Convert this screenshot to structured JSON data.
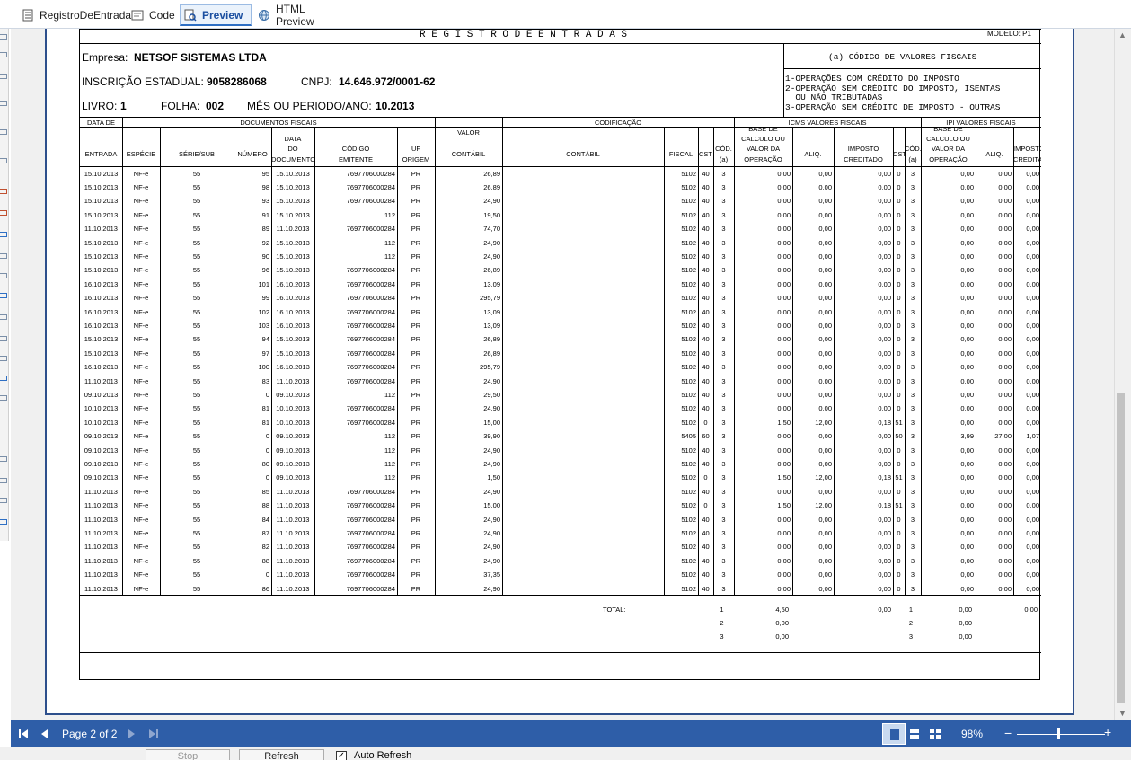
{
  "tabs": [
    {
      "label": "RegistroDeEntrada",
      "icon": "document-icon",
      "active": false
    },
    {
      "label": "Code",
      "icon": "code-icon",
      "active": false
    },
    {
      "label": "Preview",
      "icon": "preview-icon",
      "active": true
    },
    {
      "label": "HTML Preview",
      "icon": "globe-icon",
      "active": false
    }
  ],
  "report": {
    "title": "R E G I S T R O    D E    E N T R A D A S",
    "modelo": "MODELO: P1",
    "empresa_label": "Empresa:",
    "empresa": "NETSOF SISTEMAS LTDA",
    "ie_label": "INSCRIÇÃO ESTADUAL:",
    "ie": "9058286068",
    "cnpj_label": "CNPJ:",
    "cnpj": "14.646.972/0001-62",
    "livro_label": "LIVRO:",
    "livro": "1",
    "folha_label": "FOLHA:",
    "folha": "002",
    "mes_label": "MÊS OU PERIODO/ANO:",
    "mes": "10.2013",
    "codigo_title": "(a) CÓDIGO DE VALORES FISCAIS",
    "codigo_lines": [
      "1-OPERAÇÕES COM CRÉDITO DO IMPOSTO",
      "2-OPERAÇÃO SEM CRÉDITO DO IMPOSTO, ISENTAS",
      "  OU NÃO TRIBUTADAS",
      "3-OPERAÇÃO SEM CRÉDITO DE IMPOSTO - OUTRAS"
    ],
    "groups": {
      "data_de": "DATA DE",
      "documentos": "DOCUMENTOS FISCAIS",
      "codificacao": "CODIFICAÇÃO",
      "icms": "ICMS VALORES FISCAIS",
      "ipi": "IPI VALORES FISCAIS"
    },
    "headers": {
      "entrada": "ENTRADA",
      "especie": "ESPÉCIE",
      "serie": "SÉRIE/SUB",
      "numero": "NÚMERO",
      "data_doc": [
        "DATA",
        "DO",
        "DOCUMENTO"
      ],
      "codigo_emit": [
        "CÓDIGO",
        "EMITENTE"
      ],
      "uf": [
        "UF",
        "ORIGEM"
      ],
      "valor": [
        "VALOR",
        "CONTÁBIL"
      ],
      "contabil": "CONTÁBIL",
      "fiscal": "FISCAL",
      "cst": "CST",
      "cod": [
        "CÓD.",
        "(a)"
      ],
      "base": [
        "BASE DE",
        "CALCULO OU",
        "VALOR DA",
        "OPERAÇÃO"
      ],
      "aliq": "ALIQ.",
      "imposto": [
        "IMPOSTO",
        "CREDITADO"
      ]
    },
    "rows": [
      [
        "15.10.2013",
        "NF-e",
        "55",
        "95",
        "15.10.2013",
        "7697706000284",
        "PR",
        "26,89",
        "5102",
        "40",
        "3",
        "0,00",
        "0,00",
        "0,00",
        "0",
        "3",
        "0,00",
        "0,00",
        "0,00"
      ],
      [
        "15.10.2013",
        "NF-e",
        "55",
        "98",
        "15.10.2013",
        "7697706000284",
        "PR",
        "26,89",
        "5102",
        "40",
        "3",
        "0,00",
        "0,00",
        "0,00",
        "0",
        "3",
        "0,00",
        "0,00",
        "0,00"
      ],
      [
        "15.10.2013",
        "NF-e",
        "55",
        "93",
        "15.10.2013",
        "7697706000284",
        "PR",
        "24,90",
        "5102",
        "40",
        "3",
        "0,00",
        "0,00",
        "0,00",
        "0",
        "3",
        "0,00",
        "0,00",
        "0,00"
      ],
      [
        "15.10.2013",
        "NF-e",
        "55",
        "91",
        "15.10.2013",
        "112",
        "PR",
        "19,50",
        "5102",
        "40",
        "3",
        "0,00",
        "0,00",
        "0,00",
        "0",
        "3",
        "0,00",
        "0,00",
        "0,00"
      ],
      [
        "11.10.2013",
        "NF-e",
        "55",
        "89",
        "11.10.2013",
        "7697706000284",
        "PR",
        "74,70",
        "5102",
        "40",
        "3",
        "0,00",
        "0,00",
        "0,00",
        "0",
        "3",
        "0,00",
        "0,00",
        "0,00"
      ],
      [
        "15.10.2013",
        "NF-e",
        "55",
        "92",
        "15.10.2013",
        "112",
        "PR",
        "24,90",
        "5102",
        "40",
        "3",
        "0,00",
        "0,00",
        "0,00",
        "0",
        "3",
        "0,00",
        "0,00",
        "0,00"
      ],
      [
        "15.10.2013",
        "NF-e",
        "55",
        "90",
        "15.10.2013",
        "112",
        "PR",
        "24,90",
        "5102",
        "40",
        "3",
        "0,00",
        "0,00",
        "0,00",
        "0",
        "3",
        "0,00",
        "0,00",
        "0,00"
      ],
      [
        "15.10.2013",
        "NF-e",
        "55",
        "96",
        "15.10.2013",
        "7697706000284",
        "PR",
        "26,89",
        "5102",
        "40",
        "3",
        "0,00",
        "0,00",
        "0,00",
        "0",
        "3",
        "0,00",
        "0,00",
        "0,00"
      ],
      [
        "16.10.2013",
        "NF-e",
        "55",
        "101",
        "16.10.2013",
        "7697706000284",
        "PR",
        "13,09",
        "5102",
        "40",
        "3",
        "0,00",
        "0,00",
        "0,00",
        "0",
        "3",
        "0,00",
        "0,00",
        "0,00"
      ],
      [
        "16.10.2013",
        "NF-e",
        "55",
        "99",
        "16.10.2013",
        "7697706000284",
        "PR",
        "295,79",
        "5102",
        "40",
        "3",
        "0,00",
        "0,00",
        "0,00",
        "0",
        "3",
        "0,00",
        "0,00",
        "0,00"
      ],
      [
        "16.10.2013",
        "NF-e",
        "55",
        "102",
        "16.10.2013",
        "7697706000284",
        "PR",
        "13,09",
        "5102",
        "40",
        "3",
        "0,00",
        "0,00",
        "0,00",
        "0",
        "3",
        "0,00",
        "0,00",
        "0,00"
      ],
      [
        "16.10.2013",
        "NF-e",
        "55",
        "103",
        "16.10.2013",
        "7697706000284",
        "PR",
        "13,09",
        "5102",
        "40",
        "3",
        "0,00",
        "0,00",
        "0,00",
        "0",
        "3",
        "0,00",
        "0,00",
        "0,00"
      ],
      [
        "15.10.2013",
        "NF-e",
        "55",
        "94",
        "15.10.2013",
        "7697706000284",
        "PR",
        "26,89",
        "5102",
        "40",
        "3",
        "0,00",
        "0,00",
        "0,00",
        "0",
        "3",
        "0,00",
        "0,00",
        "0,00"
      ],
      [
        "15.10.2013",
        "NF-e",
        "55",
        "97",
        "15.10.2013",
        "7697706000284",
        "PR",
        "26,89",
        "5102",
        "40",
        "3",
        "0,00",
        "0,00",
        "0,00",
        "0",
        "3",
        "0,00",
        "0,00",
        "0,00"
      ],
      [
        "16.10.2013",
        "NF-e",
        "55",
        "100",
        "16.10.2013",
        "7697706000284",
        "PR",
        "295,79",
        "5102",
        "40",
        "3",
        "0,00",
        "0,00",
        "0,00",
        "0",
        "3",
        "0,00",
        "0,00",
        "0,00"
      ],
      [
        "11.10.2013",
        "NF-e",
        "55",
        "83",
        "11.10.2013",
        "7697706000284",
        "PR",
        "24,90",
        "5102",
        "40",
        "3",
        "0,00",
        "0,00",
        "0,00",
        "0",
        "3",
        "0,00",
        "0,00",
        "0,00"
      ],
      [
        "09.10.2013",
        "NF-e",
        "55",
        "0",
        "09.10.2013",
        "112",
        "PR",
        "29,50",
        "5102",
        "40",
        "3",
        "0,00",
        "0,00",
        "0,00",
        "0",
        "3",
        "0,00",
        "0,00",
        "0,00"
      ],
      [
        "10.10.2013",
        "NF-e",
        "55",
        "81",
        "10.10.2013",
        "7697706000284",
        "PR",
        "24,90",
        "5102",
        "40",
        "3",
        "0,00",
        "0,00",
        "0,00",
        "0",
        "3",
        "0,00",
        "0,00",
        "0,00"
      ],
      [
        "10.10.2013",
        "NF-e",
        "55",
        "81",
        "10.10.2013",
        "7697706000284",
        "PR",
        "15,00",
        "5102",
        "0",
        "3",
        "1,50",
        "12,00",
        "0,18",
        "51",
        "3",
        "0,00",
        "0,00",
        "0,00"
      ],
      [
        "09.10.2013",
        "NF-e",
        "55",
        "0",
        "09.10.2013",
        "112",
        "PR",
        "39,90",
        "5405",
        "60",
        "3",
        "0,00",
        "0,00",
        "0,00",
        "50",
        "3",
        "3,99",
        "27,00",
        "1,07"
      ],
      [
        "09.10.2013",
        "NF-e",
        "55",
        "0",
        "09.10.2013",
        "112",
        "PR",
        "24,90",
        "5102",
        "40",
        "3",
        "0,00",
        "0,00",
        "0,00",
        "0",
        "3",
        "0,00",
        "0,00",
        "0,00"
      ],
      [
        "09.10.2013",
        "NF-e",
        "55",
        "80",
        "09.10.2013",
        "112",
        "PR",
        "24,90",
        "5102",
        "40",
        "3",
        "0,00",
        "0,00",
        "0,00",
        "0",
        "3",
        "0,00",
        "0,00",
        "0,00"
      ],
      [
        "09.10.2013",
        "NF-e",
        "55",
        "0",
        "09.10.2013",
        "112",
        "PR",
        "1,50",
        "5102",
        "0",
        "3",
        "1,50",
        "12,00",
        "0,18",
        "51",
        "3",
        "0,00",
        "0,00",
        "0,00"
      ],
      [
        "11.10.2013",
        "NF-e",
        "55",
        "85",
        "11.10.2013",
        "7697706000284",
        "PR",
        "24,90",
        "5102",
        "40",
        "3",
        "0,00",
        "0,00",
        "0,00",
        "0",
        "3",
        "0,00",
        "0,00",
        "0,00"
      ],
      [
        "11.10.2013",
        "NF-e",
        "55",
        "88",
        "11.10.2013",
        "7697706000284",
        "PR",
        "15,00",
        "5102",
        "0",
        "3",
        "1,50",
        "12,00",
        "0,18",
        "51",
        "3",
        "0,00",
        "0,00",
        "0,00"
      ],
      [
        "11.10.2013",
        "NF-e",
        "55",
        "84",
        "11.10.2013",
        "7697706000284",
        "PR",
        "24,90",
        "5102",
        "40",
        "3",
        "0,00",
        "0,00",
        "0,00",
        "0",
        "3",
        "0,00",
        "0,00",
        "0,00"
      ],
      [
        "11.10.2013",
        "NF-e",
        "55",
        "87",
        "11.10.2013",
        "7697706000284",
        "PR",
        "24,90",
        "5102",
        "40",
        "3",
        "0,00",
        "0,00",
        "0,00",
        "0",
        "3",
        "0,00",
        "0,00",
        "0,00"
      ],
      [
        "11.10.2013",
        "NF-e",
        "55",
        "82",
        "11.10.2013",
        "7697706000284",
        "PR",
        "24,90",
        "5102",
        "40",
        "3",
        "0,00",
        "0,00",
        "0,00",
        "0",
        "3",
        "0,00",
        "0,00",
        "0,00"
      ],
      [
        "11.10.2013",
        "NF-e",
        "55",
        "88",
        "11.10.2013",
        "7697706000284",
        "PR",
        "24,90",
        "5102",
        "40",
        "3",
        "0,00",
        "0,00",
        "0,00",
        "0",
        "3",
        "0,00",
        "0,00",
        "0,00"
      ],
      [
        "11.10.2013",
        "NF-e",
        "55",
        "0",
        "11.10.2013",
        "7697706000284",
        "PR",
        "37,35",
        "5102",
        "40",
        "3",
        "0,00",
        "0,00",
        "0,00",
        "0",
        "3",
        "0,00",
        "0,00",
        "0,00"
      ],
      [
        "11.10.2013",
        "NF-e",
        "55",
        "86",
        "11.10.2013",
        "7697706000284",
        "PR",
        "24,90",
        "5102",
        "40",
        "3",
        "0,00",
        "0,00",
        "0,00",
        "0",
        "3",
        "0,00",
        "0,00",
        "0,00"
      ]
    ],
    "totals": {
      "label": "TOTAL:",
      "rows": [
        {
          "icms_cod": "1",
          "icms_base": "4,50",
          "icms_imposto": "0,00",
          "ipi_cod": "1",
          "ipi_base": "0,00",
          "ipi_imposto": "0,00"
        },
        {
          "icms_cod": "2",
          "icms_base": "0,00",
          "icms_imposto": "",
          "ipi_cod": "2",
          "ipi_base": "0,00",
          "ipi_imposto": ""
        },
        {
          "icms_cod": "3",
          "icms_base": "0,00",
          "icms_imposto": "",
          "ipi_cod": "3",
          "ipi_base": "0,00",
          "ipi_imposto": ""
        }
      ]
    }
  },
  "statusbar": {
    "page_label": "Page 2 of 2",
    "zoom": "98%"
  },
  "bottom": {
    "stop": "Stop",
    "refresh": "Refresh",
    "auto_refresh": "Auto Refresh"
  },
  "colors": {
    "statusbar": "#2e5ea8",
    "page_border": "#2d4f8c",
    "tab_active": "#2e6fc4"
  }
}
